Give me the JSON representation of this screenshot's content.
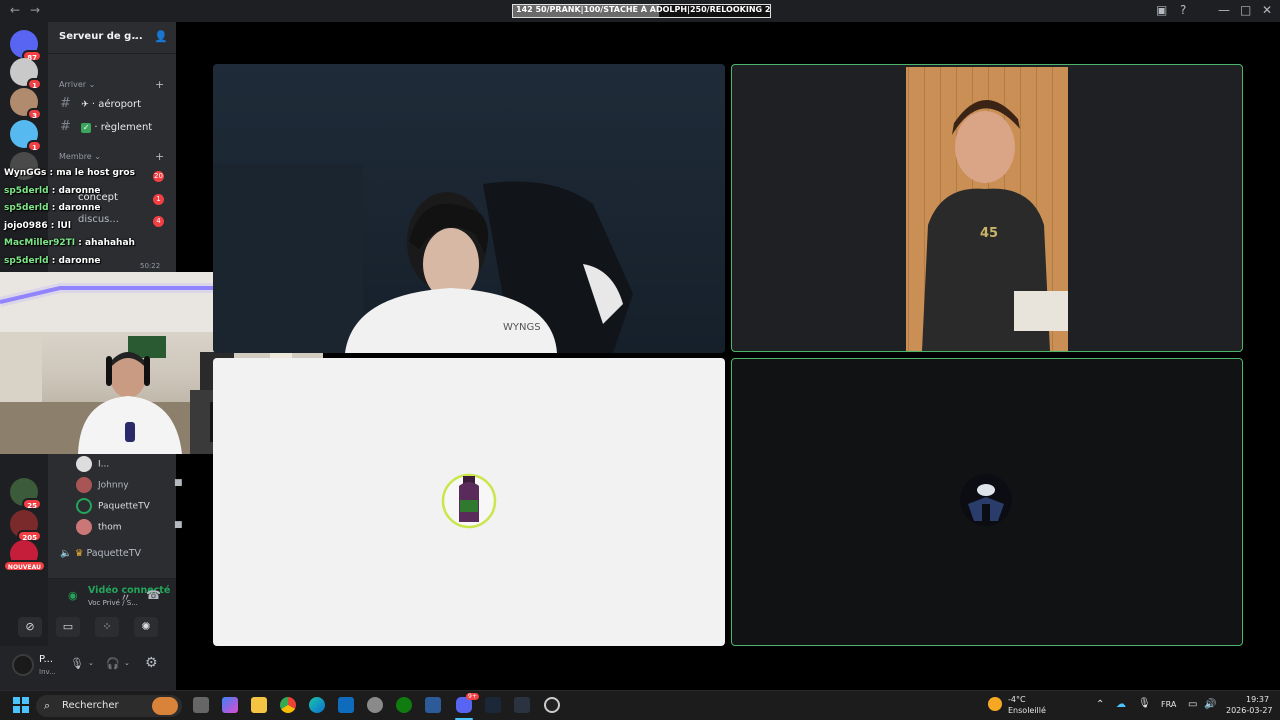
{
  "titlebar": {
    "goal_text": "142         50/PRANK|100/STACHE À ADOLPH|250/RELOOKING 250",
    "goal_progress": 0.57
  },
  "server_rail": {
    "items": [
      {
        "name": "discord-home",
        "badge": "87",
        "color": "#5865f2"
      },
      {
        "name": "server-1",
        "badge": "1",
        "color": "#c9c9c9"
      },
      {
        "name": "server-2",
        "badge": "3",
        "color": "#b08b6e"
      },
      {
        "name": "server-3",
        "badge": "1",
        "color": "#56b9f0"
      },
      {
        "name": "server-4",
        "badge": "",
        "color": "#4a4a4a"
      },
      {
        "name": "server-5",
        "badge": "25",
        "color": "#3b5b3b"
      },
      {
        "name": "server-6",
        "badge": "205",
        "color": "#7a2a2a"
      },
      {
        "name": "server-nouveau",
        "badge": "NOUVEAU",
        "color": "#c41e3a"
      }
    ]
  },
  "sidebar": {
    "server_name": "Serveur de g...",
    "category_arrive": "Arriver",
    "channels_top": [
      {
        "label": "aéroport"
      },
      {
        "label": "règlement"
      }
    ],
    "category_membre": "Membre",
    "channels_mid": [
      {
        "label": "concept",
        "badge": "1"
      },
      {
        "label": "discus...",
        "badge": "4"
      }
    ],
    "hidden_badge_1": "20",
    "voice_time": "50:22",
    "voice_users": [
      {
        "name": "I...",
        "color": "#ffffff"
      },
      {
        "name": "Johnny",
        "color": "#b5bac1"
      },
      {
        "name": "PaquetteTV",
        "color": "#ffffff"
      },
      {
        "name": "thom",
        "color": "#ffffff"
      }
    ],
    "voice_channel_2": "PaquetteTV"
  },
  "voice_panel": {
    "status": "Vidéo connecté",
    "sub": "Voc Privé / S..."
  },
  "user_panel": {
    "name": "P...",
    "sub": "Inv..."
  },
  "chat": [
    {
      "user": "WynGGs",
      "msg": ": ma le host gros",
      "color": "#ffffff"
    },
    {
      "user": "sp5derld",
      "msg": ": daronne",
      "color": "#7ee787"
    },
    {
      "user": "sp5derld",
      "msg": ": daronne",
      "color": "#7ee787"
    },
    {
      "user": "jojo0986",
      "msg": ": lUl",
      "color": "#ffffff"
    },
    {
      "user": "MacMiller92TI",
      "msg": ": ahahahah",
      "color": "#7ee787"
    },
    {
      "user": "sp5derld",
      "msg": ": daronne",
      "color": "#7ee787"
    }
  ],
  "tiles": {
    "shirt_text": "WYNGS",
    "jersey_number": "45"
  },
  "taskbar": {
    "search": "Rechercher",
    "temp": "-4°C",
    "weather": "Ensoleillé",
    "lang": "FRA",
    "time": "19:37",
    "date": "2026-03-27",
    "discord_badge": "9+"
  },
  "colors": {
    "accent_green": "#4cb56b",
    "discord_red": "#f23f43",
    "blurple": "#5865f2"
  }
}
